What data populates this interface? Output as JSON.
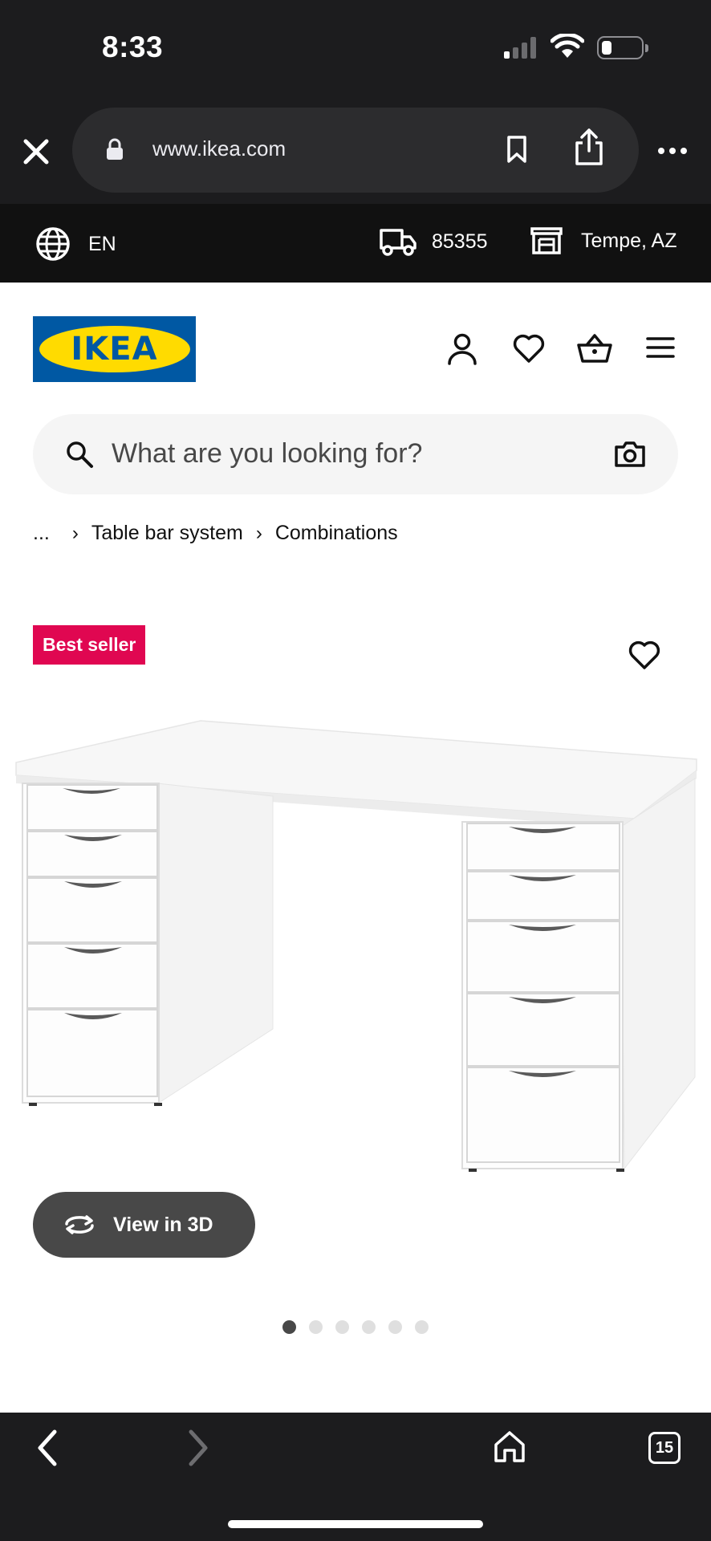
{
  "status_bar": {
    "time": "8:33"
  },
  "browser": {
    "url": "www.ikea.com",
    "tab_count": "15"
  },
  "info_bar": {
    "language": "EN",
    "zip": "85355",
    "store": "Tempe, AZ"
  },
  "brand": {
    "logo_text": "IKEA",
    "accent": "#0058a3",
    "yellow": "#ffdb00"
  },
  "search": {
    "placeholder": "What are you looking for?"
  },
  "breadcrumb": {
    "ellipsis": "...",
    "items": [
      "Table bar system",
      "Combinations"
    ]
  },
  "product": {
    "badge": "Best seller",
    "badge_color": "#e00751",
    "view3d_label": "View in 3D"
  },
  "carousel": {
    "total": 6,
    "active": 1
  }
}
